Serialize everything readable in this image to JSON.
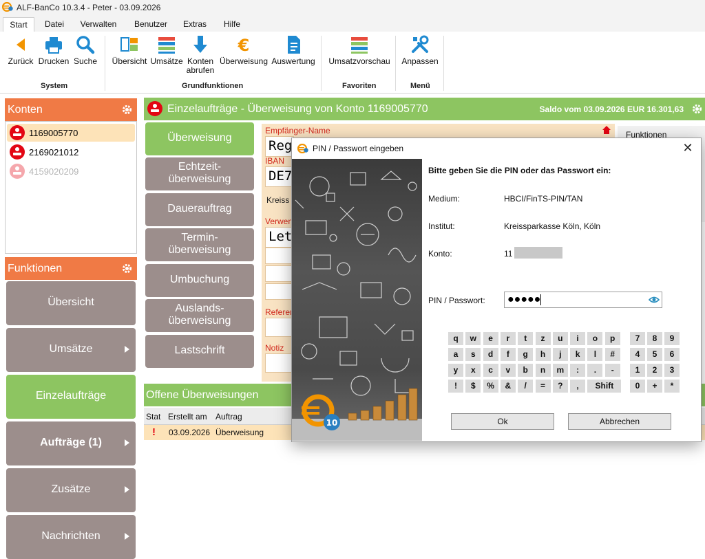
{
  "window": {
    "title": "ALF-BanCo 10.3.4 - Peter  -  03.09.2026"
  },
  "menu": {
    "tabs": [
      "Start",
      "Datei",
      "Verwalten",
      "Benutzer",
      "Extras",
      "Hilfe"
    ]
  },
  "ribbon": {
    "system": {
      "group": "System",
      "buttons": [
        "Zurück",
        "Drucken",
        "Suche"
      ]
    },
    "grund": {
      "group": "Grundfunktionen",
      "buttons": [
        "Übersicht",
        "Umsätze",
        "Konten abrufen",
        "Überweisung",
        "Auswertung"
      ]
    },
    "favoriten": {
      "group": "Favoriten",
      "buttons": [
        "Umsatzvorschau"
      ]
    },
    "menue": {
      "group": "Menü",
      "buttons": [
        "Anpassen"
      ]
    }
  },
  "konten": {
    "title": "Konten",
    "accounts": [
      "1169005770",
      "2169021012",
      "4159020209"
    ]
  },
  "funktionen": {
    "title": "Funktionen",
    "items": [
      "Übersicht",
      "Umsätze",
      "Einzelaufträge",
      "Aufträge (1)",
      "Zusätze",
      "Nachrichten"
    ]
  },
  "main": {
    "title": "Einzelaufträge - Überweisung von Konto 1169005770",
    "saldo": "Saldo vom 03.09.2026 EUR 16.301,63",
    "order_types": [
      "Überweisung",
      "Echtzeit-\nüberweisung",
      "Dauerauftrag",
      "Termin-\nüberweisung",
      "Umbuchung",
      "Auslands-\nüberweisung",
      "Lastschrift"
    ]
  },
  "form": {
    "empfaenger_label": "Empfänger-Name",
    "empfaenger_value": "Reg",
    "iban_label": "IBAN",
    "iban_value": "DE7",
    "bank_value": "Kreiss",
    "verwendung_label": "Verwen",
    "verwendung_value": "Let",
    "referenz_label": "Referen",
    "notiz_label": "Notiz"
  },
  "side_panel": {
    "title": "Funktionen"
  },
  "offene": {
    "title": "Offene Überweisungen",
    "columns": [
      "Stat",
      "Erstellt am",
      "Auftrag"
    ],
    "rows": [
      {
        "status": "!",
        "date": "03.09.2026",
        "auftrag": "Überweisung"
      }
    ]
  },
  "dialog": {
    "title": "PIN / Passwort eingeben",
    "prompt": "Bitte geben Sie die PIN oder das Passwort ein:",
    "medium_label": "Medium:",
    "medium_value": "HBCI/FinTS-PIN/TAN",
    "institut_label": "Institut:",
    "institut_value": "Kreissparkasse Köln, Köln",
    "konto_label": "Konto:",
    "konto_value": "11",
    "pin_label": "PIN / Passwort:",
    "pin_value": "●●●●●",
    "keys": [
      [
        "q",
        "w",
        "e",
        "r",
        "t",
        "z",
        "u",
        "i",
        "o",
        "p"
      ],
      [
        "a",
        "s",
        "d",
        "f",
        "g",
        "h",
        "j",
        "k",
        "l",
        "#"
      ],
      [
        "y",
        "x",
        "c",
        "v",
        "b",
        "n",
        "m",
        ":",
        ".",
        "-"
      ],
      [
        "!",
        "$",
        "%",
        "&",
        "/",
        "=",
        "?",
        ",",
        "Shift"
      ]
    ],
    "numpad": [
      [
        "7",
        "8",
        "9"
      ],
      [
        "4",
        "5",
        "6"
      ],
      [
        "1",
        "2",
        "3"
      ],
      [
        "0",
        "+",
        "*"
      ]
    ],
    "ok_label": "Ok",
    "cancel_label": "Abbrechen",
    "art_badge": "10"
  },
  "colors": {
    "orange": "#f07a45",
    "green": "#8dc561",
    "grey_button": "#9c8e8c",
    "selection": "#fde3b8",
    "sparkasse_red": "#e30613"
  }
}
